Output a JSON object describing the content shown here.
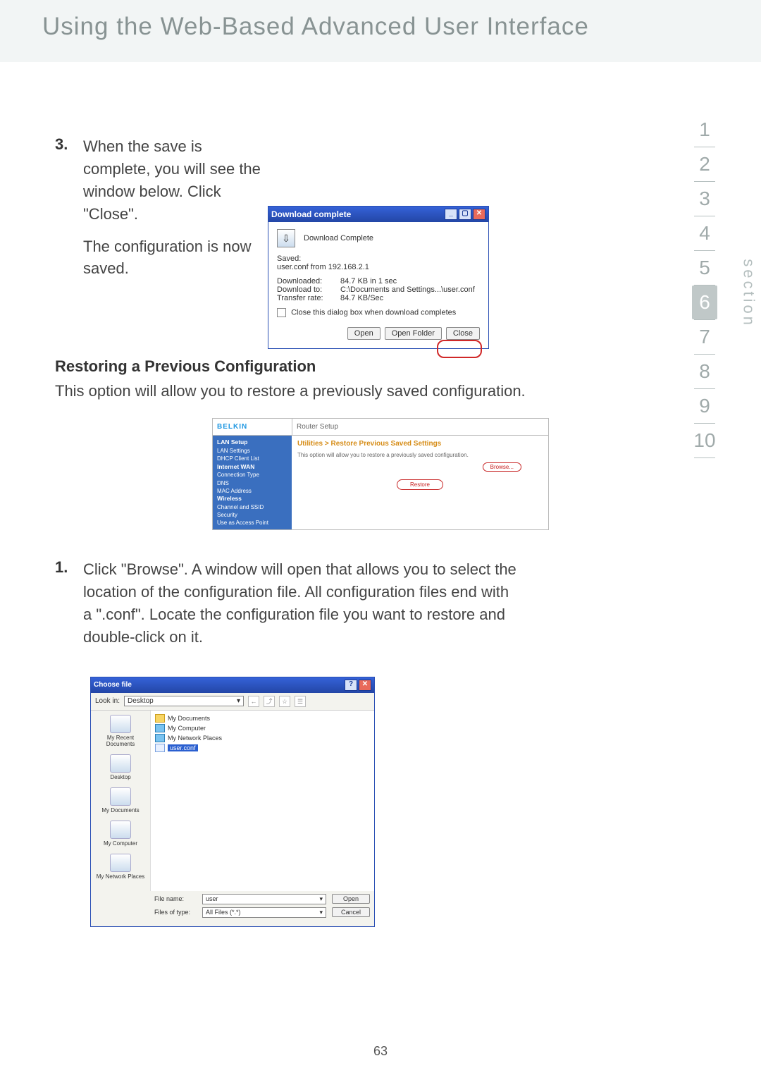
{
  "page_title": "Using the Web-Based Advanced User Interface",
  "section_label": "section",
  "section_tabs": [
    "1",
    "2",
    "3",
    "4",
    "5",
    "6",
    "7",
    "8",
    "9",
    "10"
  ],
  "active_tab_index": 5,
  "page_number": "63",
  "step3": {
    "num": "3.",
    "para1": "When the save is complete, you will see the window below. Click \"Close\".",
    "para2": "The configuration is now saved."
  },
  "download_dialog": {
    "title": "Download complete",
    "head": "Download Complete",
    "saved_label": "Saved:",
    "saved_value": "user.conf from 192.168.2.1",
    "rows": [
      {
        "label": "Downloaded:",
        "value": "84.7 KB in 1 sec"
      },
      {
        "label": "Download to:",
        "value": "C:\\Documents and Settings...\\user.conf"
      },
      {
        "label": "Transfer rate:",
        "value": "84.7 KB/Sec"
      }
    ],
    "checkbox": "Close this dialog box when download completes",
    "buttons": {
      "open": "Open",
      "open_folder": "Open Folder",
      "close": "Close"
    }
  },
  "restore": {
    "heading": "Restoring a Previous Configuration",
    "intro": "This option will allow you to restore a previously saved configuration."
  },
  "router": {
    "brand": "BELKIN",
    "header": "Router Setup",
    "nav": [
      "LAN Setup",
      "LAN Settings",
      "DHCP Client List",
      "Internet WAN",
      "Connection Type",
      "DNS",
      "MAC Address",
      "Wireless",
      "Channel and SSID",
      "Security",
      "Use as Access Point"
    ],
    "breadcrumb": "Utilities > Restore Previous Saved Settings",
    "desc": "This option will allow you to restore a previously saved configuration.",
    "browse": "Browse...",
    "restore": "Restore"
  },
  "step1": {
    "num": "1.",
    "text": "Click \"Browse\". A window will open that allows you to select the location of the configuration file. All configuration files end with a \".conf\". Locate the configuration file you want to restore and double-click on it."
  },
  "chooser": {
    "title": "Choose file",
    "lookin_label": "Look in:",
    "lookin_value": "Desktop",
    "places": [
      "My Recent Documents",
      "Desktop",
      "My Documents",
      "My Computer",
      "My Network Places"
    ],
    "files": [
      "My Documents",
      "My Computer",
      "My Network Places",
      "user.conf"
    ],
    "selected_index": 3,
    "filename_label": "File name:",
    "filename_value": "user",
    "filetype_label": "Files of type:",
    "filetype_value": "All Files (*.*)",
    "open": "Open",
    "cancel": "Cancel"
  }
}
